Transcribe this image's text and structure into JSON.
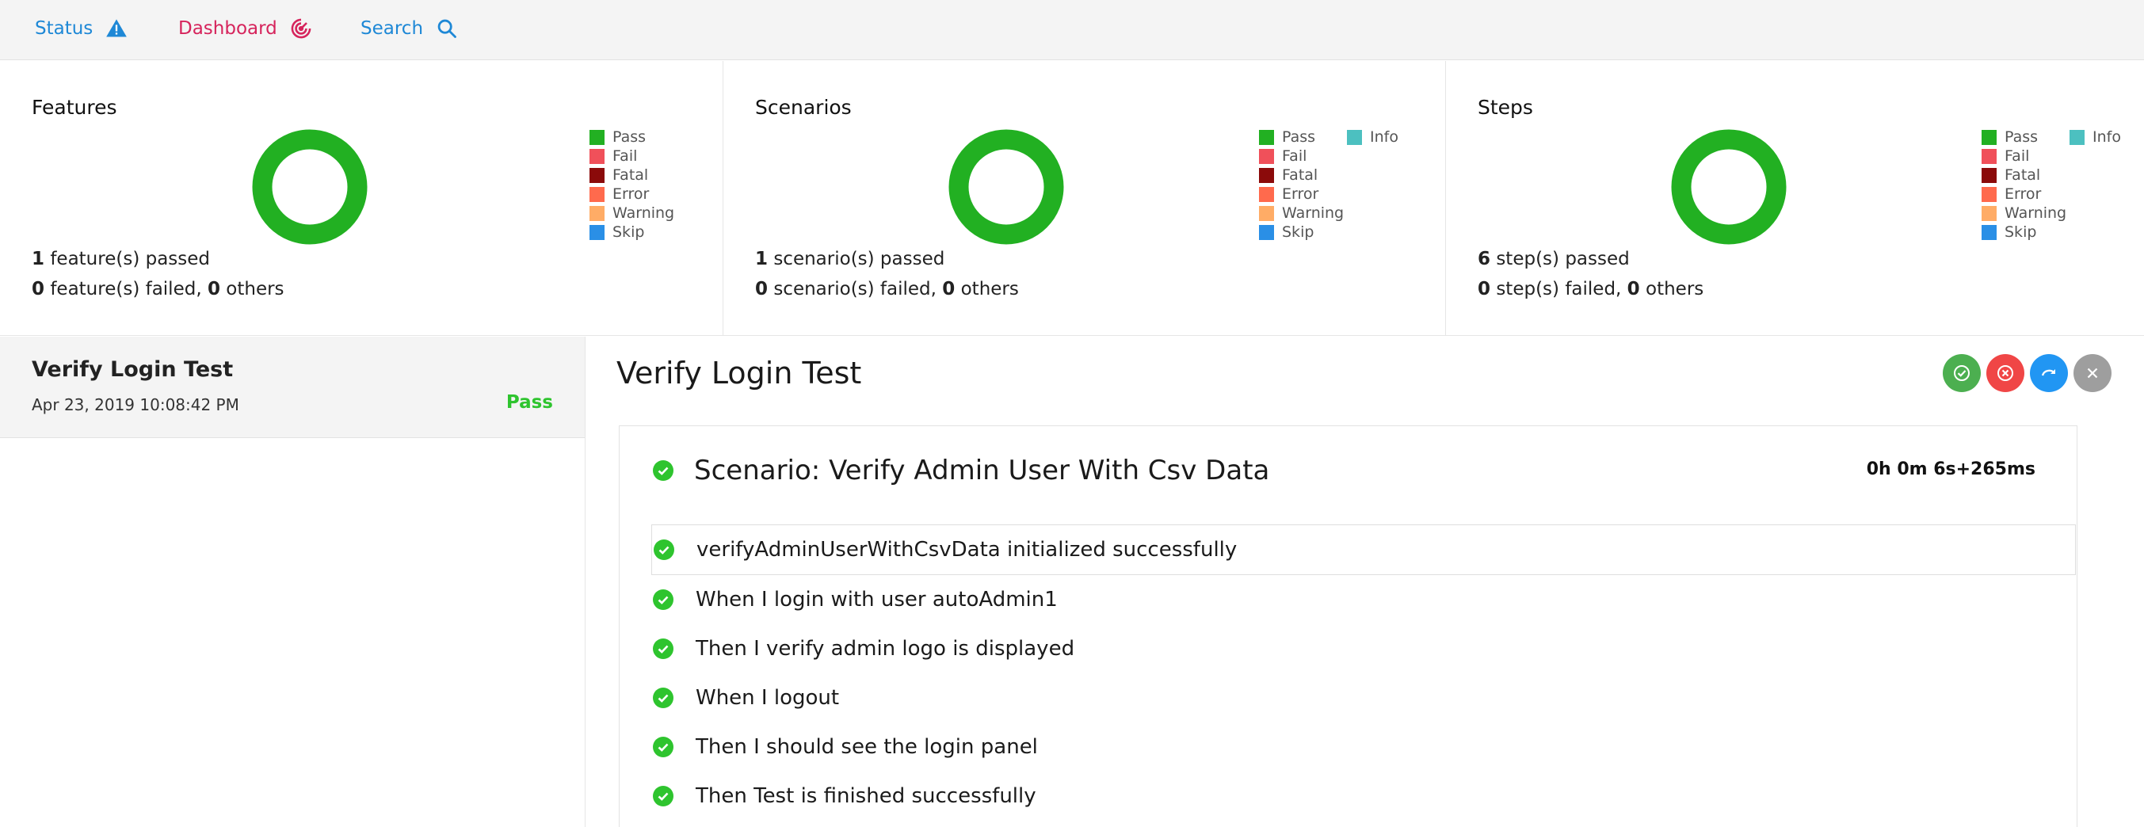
{
  "nav": {
    "status": "Status",
    "dashboard": "Dashboard",
    "search": "Search"
  },
  "colors": {
    "pass": "#22b022",
    "fail": "#f0505a",
    "fatal": "#8b0a0a",
    "error": "#ff6a4d",
    "warning": "#ffac66",
    "skip": "#2a8fe6",
    "info": "#4cc0c0"
  },
  "cards": {
    "features": {
      "title": "Features",
      "legend": [
        "Pass",
        "Fail",
        "Fatal",
        "Error",
        "Warning",
        "Skip"
      ],
      "passed_count": "1",
      "passed_text": " feature(s) passed",
      "failed_count": "0",
      "failed_text": " feature(s) failed, ",
      "others_count": "0",
      "others_text": " others",
      "pass_fraction": 1.0
    },
    "scenarios": {
      "title": "Scenarios",
      "legend": [
        "Pass",
        "Fail",
        "Fatal",
        "Error",
        "Warning",
        "Skip"
      ],
      "info": "Info",
      "passed_count": "1",
      "passed_text": " scenario(s) passed",
      "failed_count": "0",
      "failed_text": " scenario(s) failed, ",
      "others_count": "0",
      "others_text": " others",
      "pass_fraction": 1.0
    },
    "steps": {
      "title": "Steps",
      "legend": [
        "Pass",
        "Fail",
        "Fatal",
        "Error",
        "Warning",
        "Skip"
      ],
      "info": "Info",
      "passed_count": "6",
      "passed_text": " step(s) passed",
      "failed_count": "0",
      "failed_text": " step(s) failed, ",
      "others_count": "0",
      "others_text": " others",
      "pass_fraction": 1.0
    }
  },
  "test_list": [
    {
      "name": "Verify Login Test",
      "time": "Apr 23, 2019 10:08:42 PM",
      "status": "Pass"
    }
  ],
  "detail": {
    "title": "Verify Login Test",
    "scenario": {
      "name": "Scenario: Verify Admin User With Csv Data",
      "duration": "0h 0m 6s+265ms",
      "steps": [
        "verifyAdminUserWithCsvData initialized successfully",
        "When I login with user autoAdmin1",
        "Then I verify admin logo is displayed",
        "When I logout",
        "Then I should see the login panel",
        "Then Test is finished successfully"
      ]
    }
  }
}
